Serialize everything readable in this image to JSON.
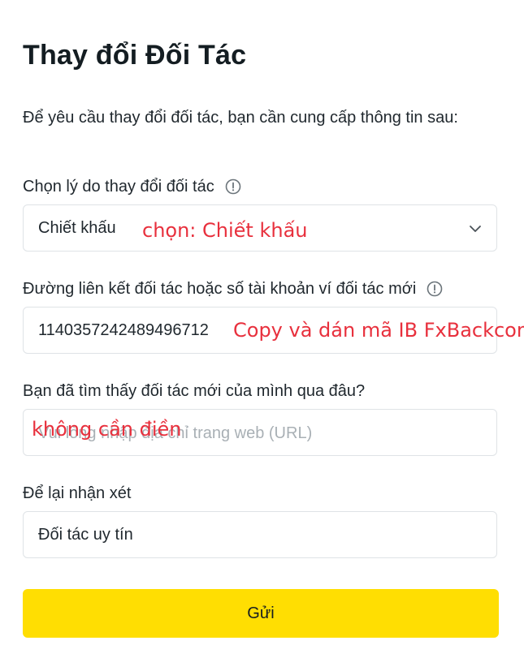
{
  "page_title": "Thay đổi Đối Tác",
  "intro": "Để yêu cầu thay đổi đối tác, bạn cần cung cấp thông tin sau:",
  "reason": {
    "label": "Chọn lý do thay đổi đối tác",
    "selected": "Chiết khấu",
    "annotation": "chọn: Chiết khấu"
  },
  "partner_link": {
    "label": "Đường liên kết đối tác hoặc số tài khoản ví đối tác mới",
    "value": "114035724248949671​2",
    "annotation": "Copy và dán mã IB FxBackcom"
  },
  "source": {
    "label": "Bạn đã tìm thấy đối tác mới của mình qua đâu?",
    "placeholder": "Vui lòng nhập địa chỉ trang web (URL)",
    "annotation": "không cần điền"
  },
  "comment": {
    "label": "Để lại nhận xét",
    "value": "Đối tác uy tín"
  },
  "submit_label": "Gửi",
  "colors": {
    "accent": "#ffde02",
    "annotation": "#e8303d",
    "border": "#dfe3e6",
    "text": "#141d22"
  }
}
